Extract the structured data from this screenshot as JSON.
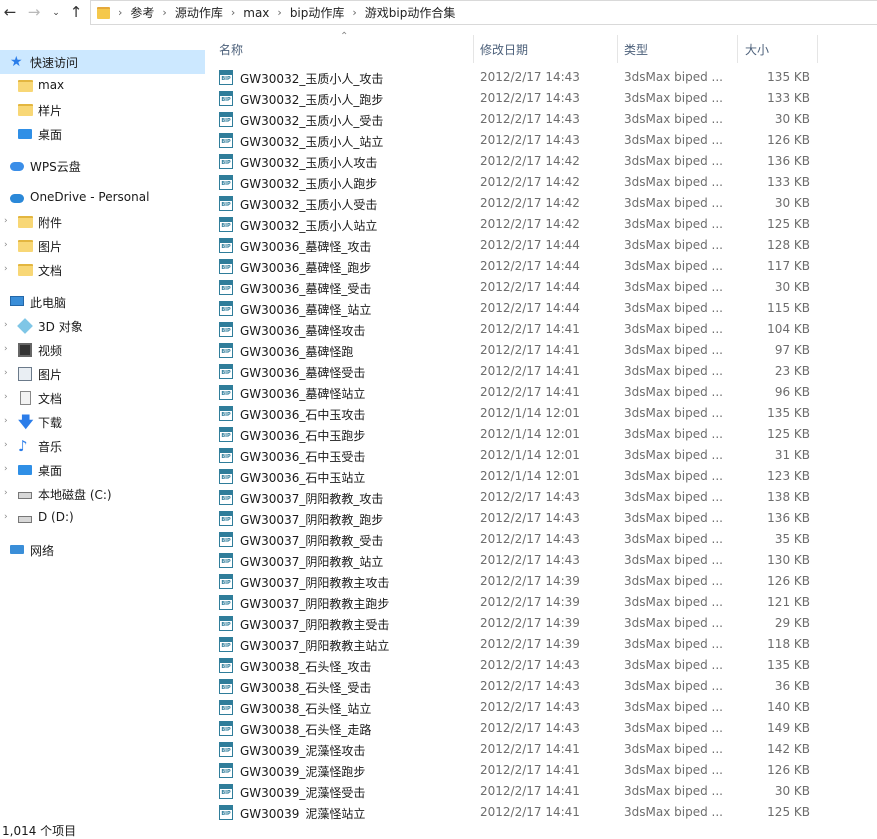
{
  "address_bar": {
    "breadcrumbs": [
      "参考",
      "源动作库",
      "max",
      "bip动作库",
      "游戏bip动作合集"
    ]
  },
  "nav_pane": {
    "items": [
      {
        "label": "快速访问",
        "icon": "star-icon"
      },
      {
        "label": "max",
        "icon": "folder-icon"
      },
      {
        "label": "样片",
        "icon": "folder-icon"
      },
      {
        "label": "桌面",
        "icon": "desktop-icon"
      },
      {
        "label": "WPS云盘",
        "icon": "cloud-icon"
      },
      {
        "label": "OneDrive - Personal",
        "icon": "cloud-icon"
      },
      {
        "label": "附件",
        "icon": "folder-icon"
      },
      {
        "label": "图片",
        "icon": "folder-icon"
      },
      {
        "label": "文档",
        "icon": "folder-icon"
      },
      {
        "label": "此电脑",
        "icon": "computer-icon"
      },
      {
        "label": "3D 对象",
        "icon": "3d-objects-icon"
      },
      {
        "label": "视频",
        "icon": "video-icon"
      },
      {
        "label": "图片",
        "icon": "pictures-icon"
      },
      {
        "label": "文档",
        "icon": "documents-icon"
      },
      {
        "label": "下载",
        "icon": "download-icon"
      },
      {
        "label": "音乐",
        "icon": "music-icon"
      },
      {
        "label": "桌面",
        "icon": "desktop-icon"
      },
      {
        "label": "本地磁盘 (C:)",
        "icon": "drive-icon"
      },
      {
        "label": "D (D:)",
        "icon": "drive-icon"
      },
      {
        "label": "网络",
        "icon": "network-icon"
      }
    ]
  },
  "columns": {
    "name": "名称",
    "date": "修改日期",
    "type": "类型",
    "size": "大小"
  },
  "files": [
    {
      "name": "GW30032_玉质小人_攻击",
      "date": "2012/2/17 14:43",
      "type": "3dsMax biped ...",
      "size": "135 KB"
    },
    {
      "name": "GW30032_玉质小人_跑步",
      "date": "2012/2/17 14:43",
      "type": "3dsMax biped ...",
      "size": "133 KB"
    },
    {
      "name": "GW30032_玉质小人_受击",
      "date": "2012/2/17 14:43",
      "type": "3dsMax biped ...",
      "size": "30 KB"
    },
    {
      "name": "GW30032_玉质小人_站立",
      "date": "2012/2/17 14:43",
      "type": "3dsMax biped ...",
      "size": "126 KB"
    },
    {
      "name": "GW30032_玉质小人攻击",
      "date": "2012/2/17 14:42",
      "type": "3dsMax biped ...",
      "size": "136 KB"
    },
    {
      "name": "GW30032_玉质小人跑步",
      "date": "2012/2/17 14:42",
      "type": "3dsMax biped ...",
      "size": "133 KB"
    },
    {
      "name": "GW30032_玉质小人受击",
      "date": "2012/2/17 14:42",
      "type": "3dsMax biped ...",
      "size": "30 KB"
    },
    {
      "name": "GW30032_玉质小人站立",
      "date": "2012/2/17 14:42",
      "type": "3dsMax biped ...",
      "size": "125 KB"
    },
    {
      "name": "GW30036_墓碑怪_攻击",
      "date": "2012/2/17 14:44",
      "type": "3dsMax biped ...",
      "size": "128 KB"
    },
    {
      "name": "GW30036_墓碑怪_跑步",
      "date": "2012/2/17 14:44",
      "type": "3dsMax biped ...",
      "size": "117 KB"
    },
    {
      "name": "GW30036_墓碑怪_受击",
      "date": "2012/2/17 14:44",
      "type": "3dsMax biped ...",
      "size": "30 KB"
    },
    {
      "name": "GW30036_墓碑怪_站立",
      "date": "2012/2/17 14:44",
      "type": "3dsMax biped ...",
      "size": "115 KB"
    },
    {
      "name": "GW30036_墓碑怪攻击",
      "date": "2012/2/17 14:41",
      "type": "3dsMax biped ...",
      "size": "104 KB"
    },
    {
      "name": "GW30036_墓碑怪跑",
      "date": "2012/2/17 14:41",
      "type": "3dsMax biped ...",
      "size": "97 KB"
    },
    {
      "name": "GW30036_墓碑怪受击",
      "date": "2012/2/17 14:41",
      "type": "3dsMax biped ...",
      "size": "23 KB"
    },
    {
      "name": "GW30036_墓碑怪站立",
      "date": "2012/2/17 14:41",
      "type": "3dsMax biped ...",
      "size": "96 KB"
    },
    {
      "name": "GW30036_石中玉攻击",
      "date": "2012/1/14 12:01",
      "type": "3dsMax biped ...",
      "size": "135 KB"
    },
    {
      "name": "GW30036_石中玉跑步",
      "date": "2012/1/14 12:01",
      "type": "3dsMax biped ...",
      "size": "125 KB"
    },
    {
      "name": "GW30036_石中玉受击",
      "date": "2012/1/14 12:01",
      "type": "3dsMax biped ...",
      "size": "31 KB"
    },
    {
      "name": "GW30036_石中玉站立",
      "date": "2012/1/14 12:01",
      "type": "3dsMax biped ...",
      "size": "123 KB"
    },
    {
      "name": "GW30037_阴阳教教_攻击",
      "date": "2012/2/17 14:43",
      "type": "3dsMax biped ...",
      "size": "138 KB"
    },
    {
      "name": "GW30037_阴阳教教_跑步",
      "date": "2012/2/17 14:43",
      "type": "3dsMax biped ...",
      "size": "136 KB"
    },
    {
      "name": "GW30037_阴阳教教_受击",
      "date": "2012/2/17 14:43",
      "type": "3dsMax biped ...",
      "size": "35 KB"
    },
    {
      "name": "GW30037_阴阳教教_站立",
      "date": "2012/2/17 14:43",
      "type": "3dsMax biped ...",
      "size": "130 KB"
    },
    {
      "name": "GW30037_阴阳教教主攻击",
      "date": "2012/2/17 14:39",
      "type": "3dsMax biped ...",
      "size": "126 KB"
    },
    {
      "name": "GW30037_阴阳教教主跑步",
      "date": "2012/2/17 14:39",
      "type": "3dsMax biped ...",
      "size": "121 KB"
    },
    {
      "name": "GW30037_阴阳教教主受击",
      "date": "2012/2/17 14:39",
      "type": "3dsMax biped ...",
      "size": "29 KB"
    },
    {
      "name": "GW30037_阴阳教教主站立",
      "date": "2012/2/17 14:39",
      "type": "3dsMax biped ...",
      "size": "118 KB"
    },
    {
      "name": "GW30038_石头怪_攻击",
      "date": "2012/2/17 14:43",
      "type": "3dsMax biped ...",
      "size": "135 KB"
    },
    {
      "name": "GW30038_石头怪_受击",
      "date": "2012/2/17 14:43",
      "type": "3dsMax biped ...",
      "size": "36 KB"
    },
    {
      "name": "GW30038_石头怪_站立",
      "date": "2012/2/17 14:43",
      "type": "3dsMax biped ...",
      "size": "140 KB"
    },
    {
      "name": "GW30038_石头怪_走路",
      "date": "2012/2/17 14:43",
      "type": "3dsMax biped ...",
      "size": "149 KB"
    },
    {
      "name": "GW30039_泥藻怪攻击",
      "date": "2012/2/17 14:41",
      "type": "3dsMax biped ...",
      "size": "142 KB"
    },
    {
      "name": "GW30039_泥藻怪跑步",
      "date": "2012/2/17 14:41",
      "type": "3dsMax biped ...",
      "size": "126 KB"
    },
    {
      "name": "GW30039_泥藻怪受击",
      "date": "2012/2/17 14:41",
      "type": "3dsMax biped ...",
      "size": "30 KB"
    },
    {
      "name": "GW30039_泥藻怪站立",
      "date": "2012/2/17 14:41",
      "type": "3dsMax biped ...",
      "size": "125 KB"
    }
  ],
  "file_icon_label": "BIP",
  "status_bar": {
    "item_count": "1,014 个项目"
  },
  "colors": {
    "selection": "#cce8ff",
    "header_text": "#4c607a",
    "detail_text": "#6d6d6d"
  }
}
